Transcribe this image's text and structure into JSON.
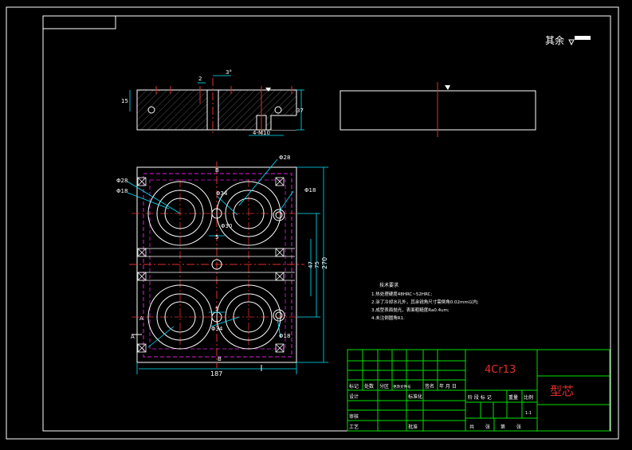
{
  "drawing": {
    "surface_finish_note": "其余",
    "material": "4Cr13",
    "part_name": "型芯",
    "tech_requirements": {
      "title": "技术要求",
      "items": [
        "1.热处理硬度48HRC~52HRC;",
        "2.涂了冷却水孔外，其余锐角尺寸需倒角0.02mm以内;",
        "3.成型表面抛光，表面粗糙度Ra0.4um;",
        "4.未注倒圆角R1."
      ]
    },
    "dimensions": {
      "side_angle": "3°",
      "side_2": "2",
      "side_left": "15",
      "side_height": "37",
      "side_thread": "4-M10",
      "d28_top": "Φ28",
      "d28_left": "Φ28",
      "d18_left": "Φ18",
      "d18_right": "Φ18",
      "d34_top": "Φ34",
      "d34_bot": "Φ34",
      "d30": "Φ30",
      "d18_bot": "Φ18",
      "w5a": "5",
      "w5b": "5",
      "h47": "47",
      "h75": "75",
      "h270": "270",
      "w187": "187"
    },
    "section_labels": {
      "a1": "A",
      "a2": "A",
      "b1": "B",
      "b2": "B"
    },
    "title_block": {
      "r_biaoji": "标记",
      "r_chushu": "处数",
      "r_fenqu": "分区",
      "r_gengai": "更改文件号",
      "r_qianming": "签名",
      "r_nianyueri": "年 月 日",
      "r_sheji": "设计",
      "r_biaozhunhua": "标准化",
      "r_shenhe": "审核",
      "r_gongyi": "工艺",
      "r_pizhun": "批准",
      "r_jieduan": "阶 段 标 记",
      "r_zhongliang": "重量",
      "r_bili": "比例",
      "r_scale": "1:1",
      "r_gong": "共",
      "r_zhang1": "张",
      "r_di": "第",
      "r_zhang2": "张"
    }
  }
}
